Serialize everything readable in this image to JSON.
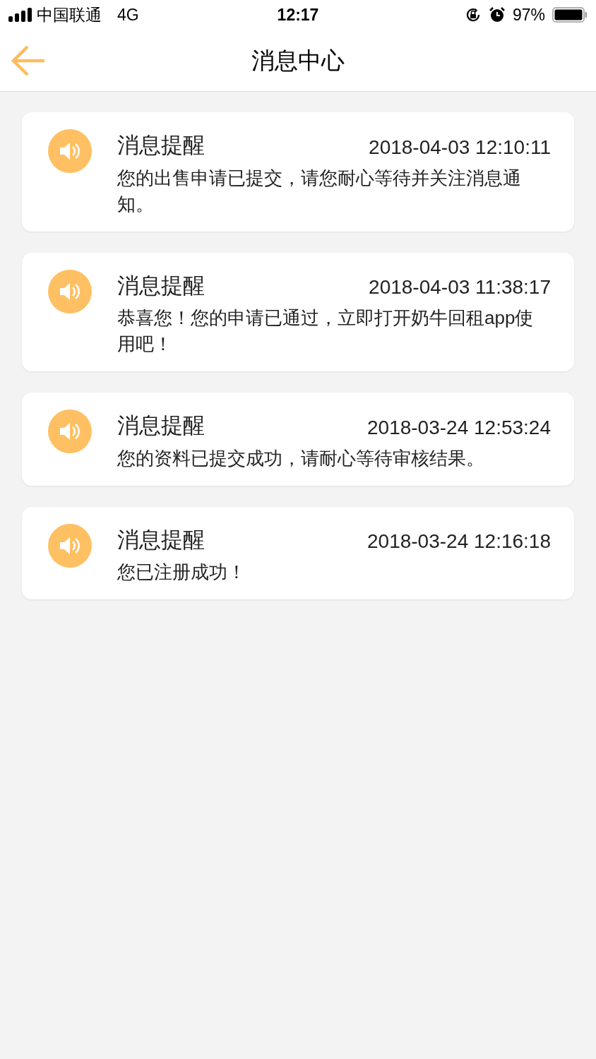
{
  "status_bar": {
    "carrier": "中国联通",
    "network": "4G",
    "time": "12:17",
    "battery": "97%"
  },
  "nav": {
    "title": "消息中心"
  },
  "messages": [
    {
      "title": "消息提醒",
      "time": "2018-04-03 12:10:11",
      "body": "您的出售申请已提交，请您耐心等待并关注消息通知。"
    },
    {
      "title": "消息提醒",
      "time": "2018-04-03 11:38:17",
      "body": "恭喜您！您的申请已通过，立即打开奶牛回租app使用吧！"
    },
    {
      "title": "消息提醒",
      "time": "2018-03-24 12:53:24",
      "body": "您的资料已提交成功，请耐心等待审核结果。"
    },
    {
      "title": "消息提醒",
      "time": "2018-03-24 12:16:18",
      "body": "您已注册成功！"
    }
  ]
}
